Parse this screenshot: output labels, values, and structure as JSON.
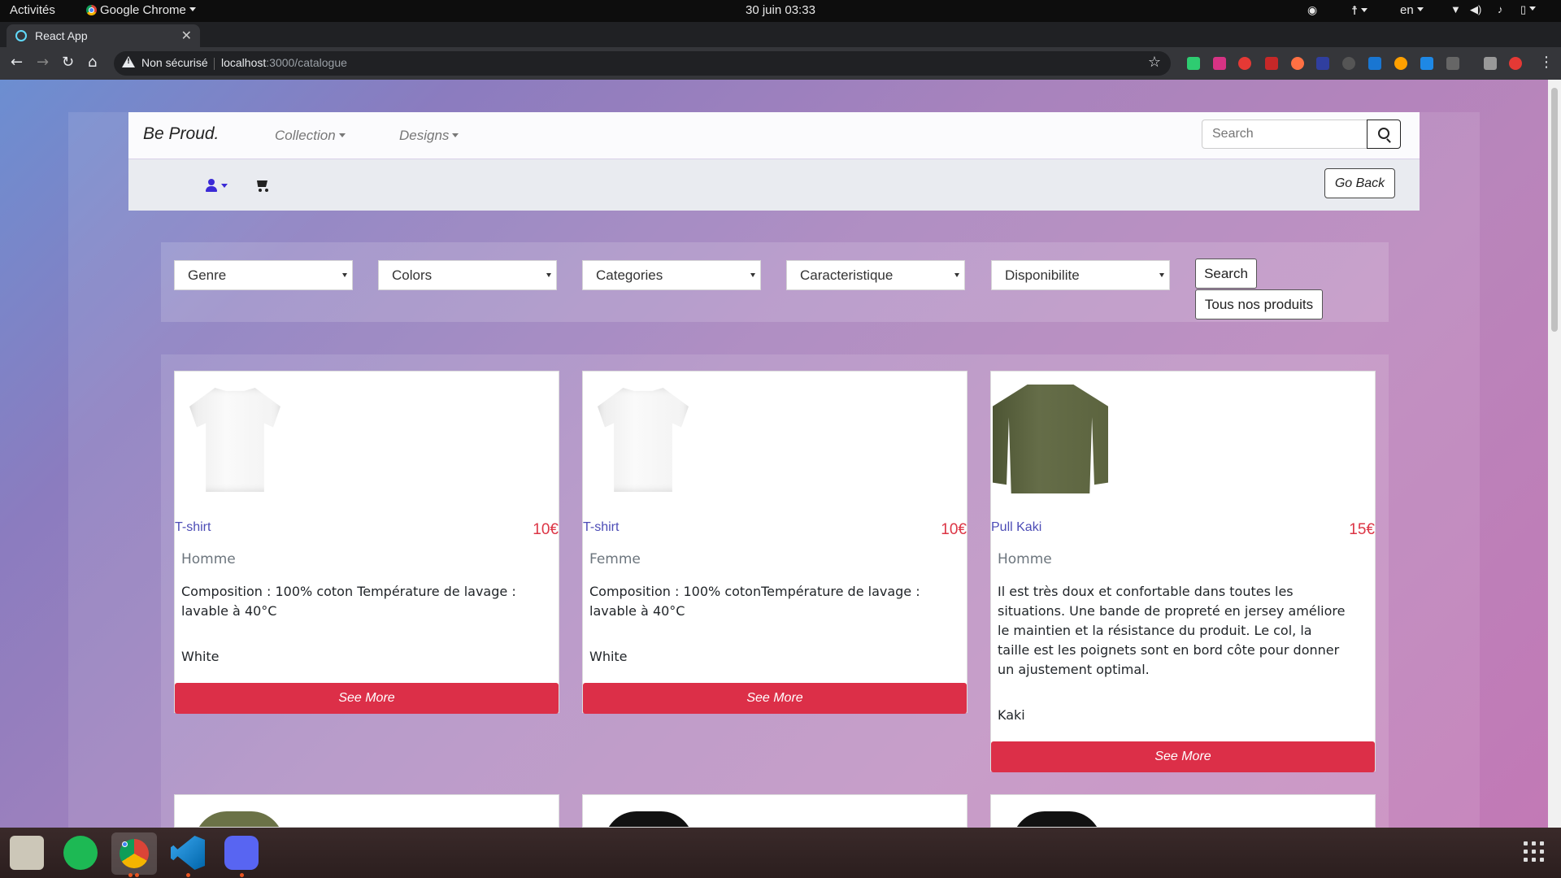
{
  "system": {
    "activities": "Activités",
    "app_name": "Google Chrome",
    "datetime": "30 juin  03:33",
    "language": "en"
  },
  "browser": {
    "tab_title": "React App",
    "security_label": "Non sécurisé",
    "url_host": "localhost",
    "url_path": ":3000/catalogue"
  },
  "navbar": {
    "brand": "Be Proud.",
    "collection": "Collection",
    "designs": "Designs",
    "search_placeholder": "Search",
    "go_back": "Go Back"
  },
  "filters": {
    "genre": "Genre",
    "colors": "Colors",
    "categories": "Categories",
    "caracteristique": "Caracteristique",
    "disponibilite": "Disponibilite",
    "search_button": "Search",
    "all_products_button": "Tous nos produits"
  },
  "products": [
    {
      "name": "T-shirt",
      "price": "10€",
      "genre": "Homme",
      "description": "Composition : 100% coton Température de lavage : lavable à 40°C",
      "color": "White",
      "button": "See More"
    },
    {
      "name": "T-shirt",
      "price": "10€",
      "genre": "Femme",
      "description": "Composition : 100% cotonTempérature de lavage : lavable à 40°C",
      "color": "White",
      "button": "See More"
    },
    {
      "name": "Pull Kaki",
      "price": "15€",
      "genre": "Homme",
      "description": "Il est très doux et confortable dans toutes les situations. Une bande de propreté en jersey améliore le maintien et la résistance du produit. Le col, la taille est les poignets sont en bord côte pour donner un ajustement optimal.",
      "color": "Kaki",
      "button": "See More"
    }
  ],
  "colors": {
    "accent_red": "#dc2f48",
    "price_red": "#dc3545",
    "link_blue": "#4c4cb6",
    "user_icon": "#3b2ad6"
  }
}
